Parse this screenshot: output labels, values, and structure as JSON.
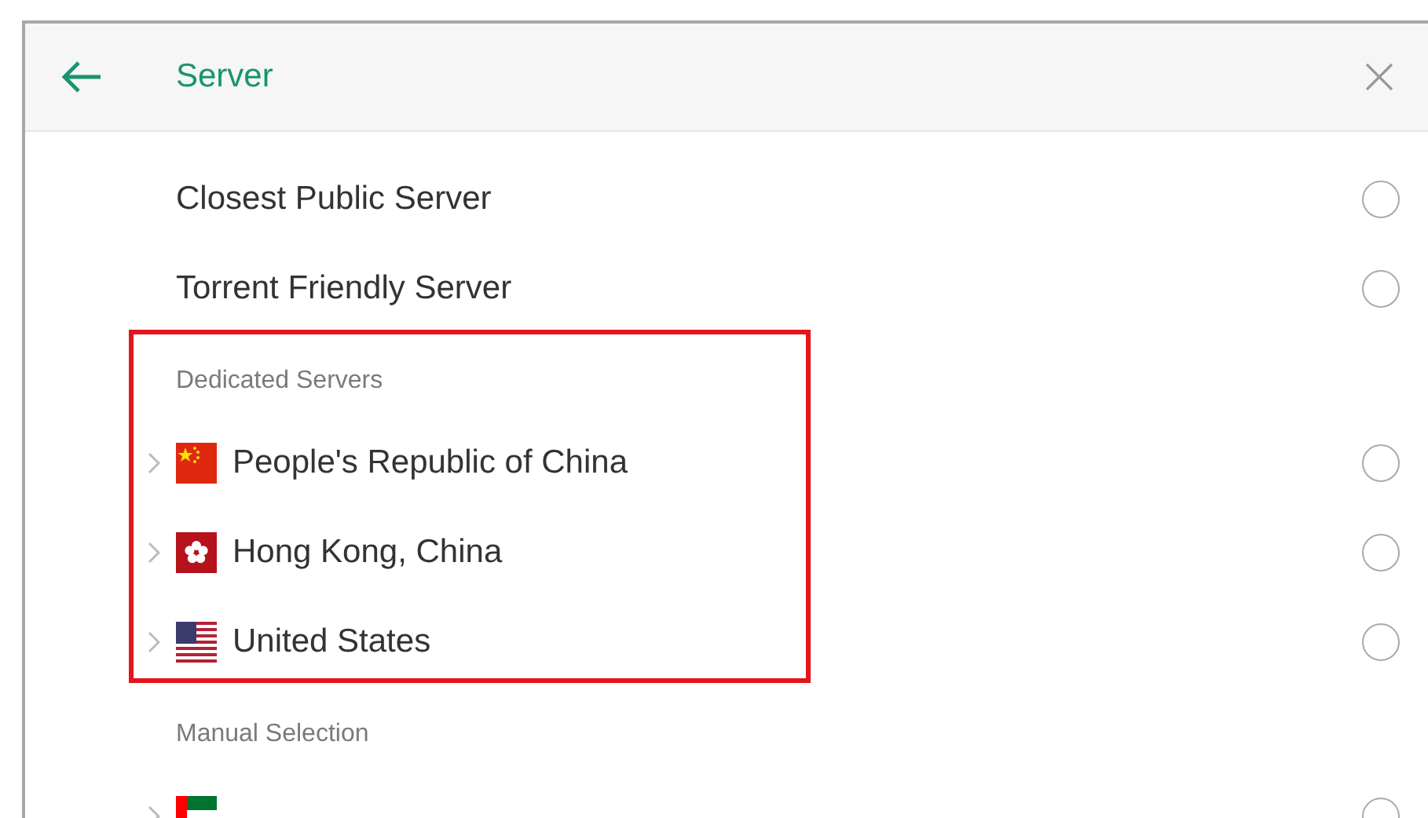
{
  "header": {
    "title": "Server"
  },
  "options": [
    {
      "label": "Closest Public Server",
      "selected": false
    },
    {
      "label": "Torrent Friendly Server",
      "selected": false
    }
  ],
  "sections": [
    {
      "title": "Dedicated Servers",
      "highlighted": true,
      "items": [
        {
          "label": "People's Republic of China",
          "kind": "cn",
          "selected": false
        },
        {
          "label": "Hong Kong, China",
          "kind": "hk",
          "selected": false
        },
        {
          "label": "United States",
          "kind": "us",
          "selected": false
        }
      ]
    },
    {
      "title": "Manual Selection",
      "highlighted": false,
      "items": [
        {
          "kind": "ae",
          "selected": false
        }
      ]
    }
  ]
}
